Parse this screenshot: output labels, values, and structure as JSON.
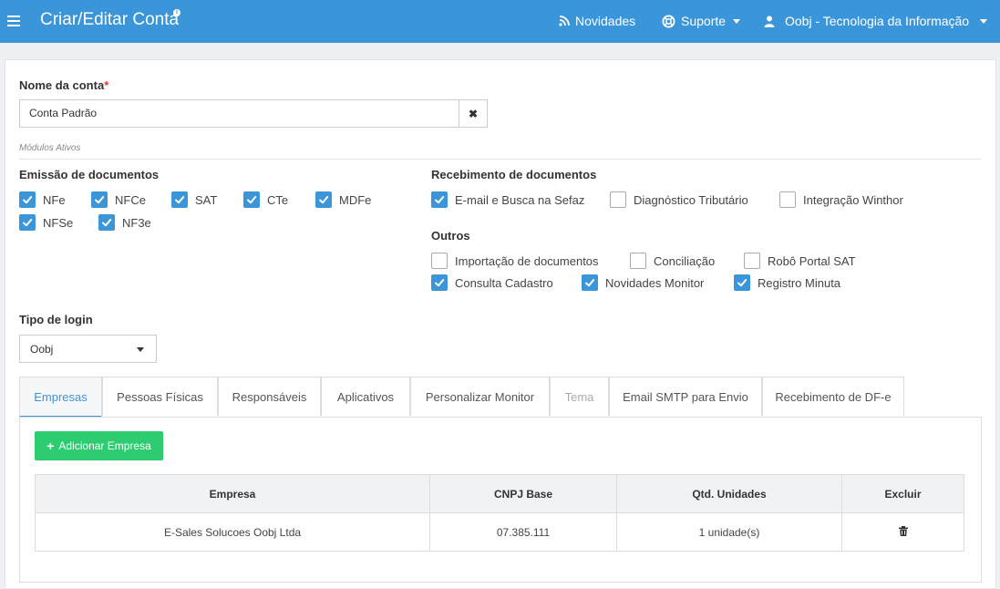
{
  "header": {
    "title": "Criar/Editar Conta",
    "info_badge": "i",
    "nav": {
      "novidades": "Novidades",
      "suporte": "Suporte",
      "user": "Oobj - Tecnologia da Informação"
    }
  },
  "form": {
    "account_name_label": "Nome da conta",
    "required_mark": "*",
    "account_name_value": "Conta Padrão",
    "clear_symbol": "✖",
    "modules_note": "Módulos Ativos"
  },
  "emissao": {
    "title": "Emissão de documentos",
    "items": [
      {
        "label": "NFe",
        "checked": true
      },
      {
        "label": "NFCe",
        "checked": true
      },
      {
        "label": "SAT",
        "checked": true
      },
      {
        "label": "CTe",
        "checked": true
      },
      {
        "label": "MDFe",
        "checked": true
      },
      {
        "label": "NFSe",
        "checked": true
      },
      {
        "label": "NF3e",
        "checked": true
      }
    ]
  },
  "recebimento": {
    "title": "Recebimento de documentos",
    "items": [
      {
        "label": "E-mail e Busca na Sefaz",
        "checked": true
      },
      {
        "label": "Diagnóstico Tributário",
        "checked": false
      },
      {
        "label": "Integração Winthor",
        "checked": false
      }
    ]
  },
  "outros": {
    "title": "Outros",
    "items": [
      {
        "label": "Importação de documentos",
        "checked": false
      },
      {
        "label": "Conciliação",
        "checked": false
      },
      {
        "label": "Robô Portal SAT",
        "checked": false
      },
      {
        "label": "Consulta Cadastro",
        "checked": true
      },
      {
        "label": "Novidades Monitor",
        "checked": true
      },
      {
        "label": "Registro Minuta",
        "checked": true
      }
    ]
  },
  "login": {
    "label": "Tipo de login",
    "selected": "Oobj"
  },
  "tabs": [
    {
      "label": "Empresas",
      "active": true
    },
    {
      "label": "Pessoas Físicas"
    },
    {
      "label": "Responsáveis"
    },
    {
      "label": "Aplicativos"
    },
    {
      "label": "Personalizar Monitor"
    },
    {
      "label": "Tema",
      "disabled": true
    },
    {
      "label": "Email SMTP para Envio"
    },
    {
      "label": "Recebimento de DF-e"
    }
  ],
  "empresas": {
    "add_button": "Adicionar Empresa",
    "columns": [
      "Empresa",
      "CNPJ Base",
      "Qtd. Unidades",
      "Excluir"
    ],
    "rows": [
      {
        "empresa": "E-Sales Solucoes Oobj Ltda",
        "cnpj": "07.385.111",
        "qtd": "1 unidade(s)"
      }
    ]
  },
  "colors": {
    "primary": "#3b95d9",
    "success": "#2ecc71"
  }
}
